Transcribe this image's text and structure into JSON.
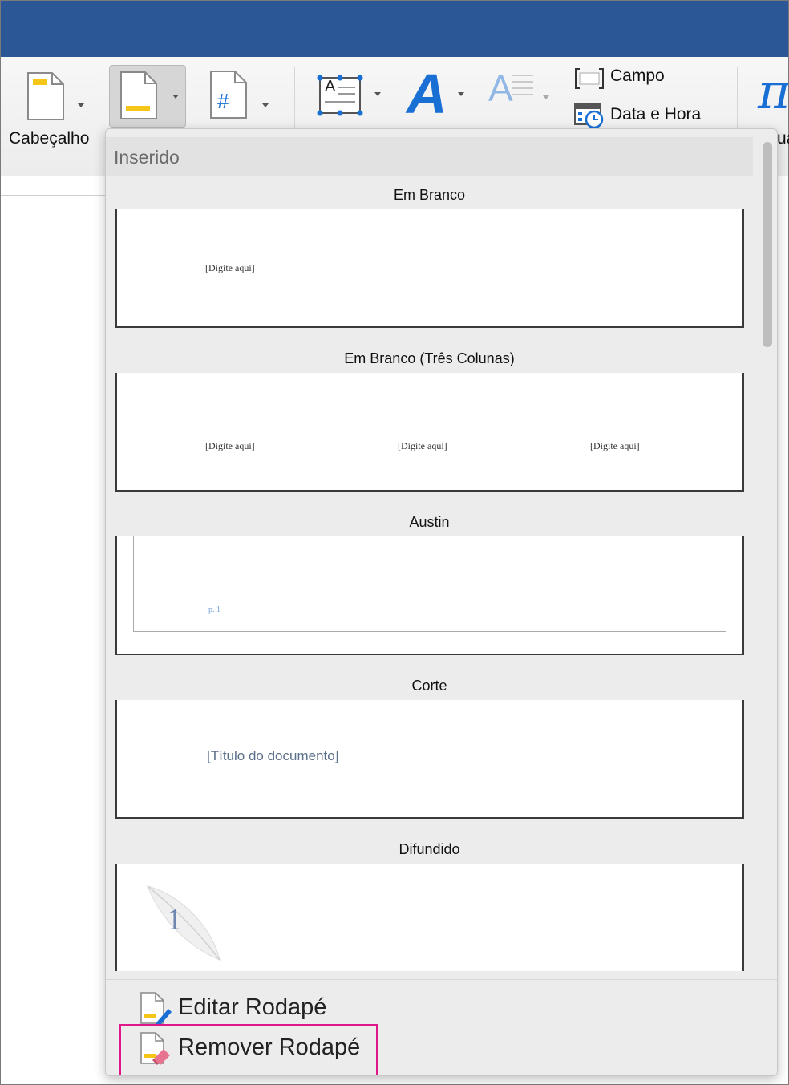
{
  "ribbon": {
    "header_label": "Cabeçalho",
    "field_label": "Campo",
    "datetime_label": "Data e Hora",
    "equation_glyph": "π",
    "partial_label": "ua",
    "page_number_glyph": "#",
    "textbox_glyph": "A",
    "wordart_glyph": "A",
    "dropcap_glyph": "A"
  },
  "dropdown": {
    "section_title": "Inserido",
    "gallery": [
      {
        "title": "Em Branco",
        "placeholders": [
          "[Digite aqui]"
        ]
      },
      {
        "title": "Em Branco (Três Colunas)",
        "placeholders": [
          "[Digite aqui]",
          "[Digite aqui]",
          "[Digite aqui]"
        ]
      },
      {
        "title": "Austin",
        "placeholders": [
          "p. 1"
        ]
      },
      {
        "title": "Corte",
        "placeholders": [
          "[Título do documento]"
        ]
      },
      {
        "title": "Difundido",
        "placeholders": [
          "1"
        ]
      }
    ],
    "actions": {
      "edit_footer": "Editar Rodapé",
      "remove_footer": "Remover Rodapé"
    }
  },
  "colors": {
    "titlebar": "#2b5797",
    "highlight": "#e0168a",
    "accent_blue": "#1a6fd4",
    "icon_yellow": "#f5c518"
  }
}
